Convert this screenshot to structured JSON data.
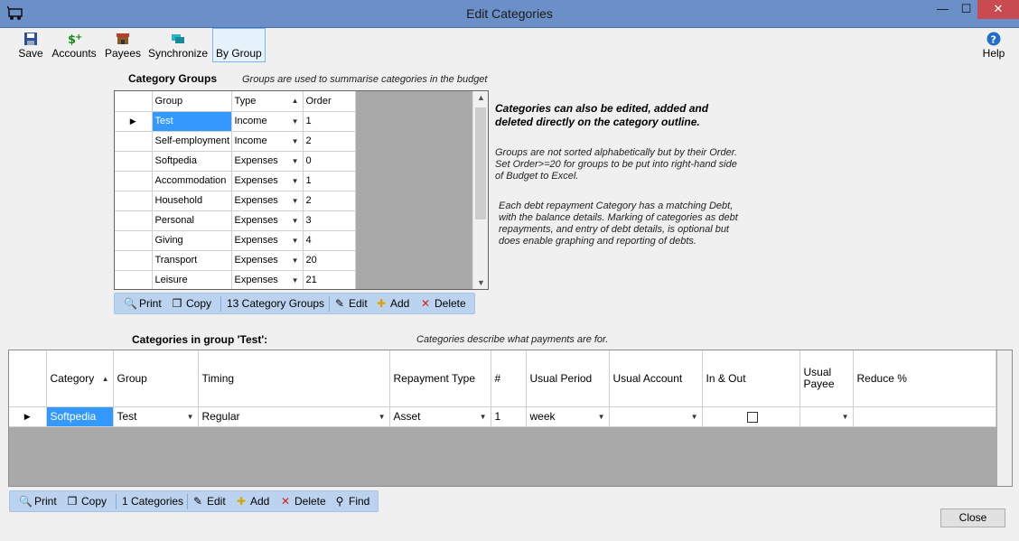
{
  "window": {
    "title": "Edit Categories",
    "close_glyph": "✕",
    "min_glyph": "—",
    "max_glyph": "☐"
  },
  "toolbar": {
    "save": "Save",
    "accounts": "Accounts",
    "payees": "Payees",
    "synchronize": "Synchronize",
    "by_group": "By Group",
    "help": "Help"
  },
  "groups_section": {
    "title": "Category Groups",
    "hint": "Groups are used to summarise categories in the budget",
    "columns": [
      "Group",
      "Type",
      "Order"
    ],
    "rows": [
      {
        "group": "Test",
        "type": "Income",
        "order": "1"
      },
      {
        "group": "Self-employment",
        "type": "Income",
        "order": "2"
      },
      {
        "group": "Softpedia",
        "type": "Expenses",
        "order": "0"
      },
      {
        "group": "Accommodation",
        "type": "Expenses",
        "order": "1"
      },
      {
        "group": "Household",
        "type": "Expenses",
        "order": "2"
      },
      {
        "group": "Personal",
        "type": "Expenses",
        "order": "3"
      },
      {
        "group": "Giving",
        "type": "Expenses",
        "order": "4"
      },
      {
        "group": "Transport",
        "type": "Expenses",
        "order": "20"
      },
      {
        "group": "Leisure",
        "type": "Expenses",
        "order": "21"
      }
    ],
    "strip": {
      "print": "Print",
      "copy": "Copy",
      "count": "13 Category Groups",
      "edit": "Edit",
      "add": "Add",
      "delete": "Delete"
    }
  },
  "info": {
    "bold": "Categories can also be edited, added and deleted directly on the category outline.",
    "p1": "Groups are not sorted alphabetically but by their Order. Set Order>=20 for groups to be put into right-hand side of Budget to Excel.",
    "p2": "Each debt repayment Category has a matching Debt, with the balance details. Marking of categories as debt repayments, and entry of debt details, is optional but does enable graphing and reporting of debts."
  },
  "categories_section": {
    "title": "Categories in group 'Test':",
    "hint": "Categories describe what payments are for.",
    "columns": [
      "Category",
      "Group",
      "Timing",
      "Repayment Type",
      "#",
      "Usual Period",
      "Usual Account",
      "In & Out",
      "Usual Payee",
      "Reduce %"
    ],
    "rows": [
      {
        "category": "Softpedia",
        "group": "Test",
        "timing": "Regular",
        "repayment_type": "Asset",
        "num": "1",
        "usual_period": "week",
        "usual_account": "",
        "in_out": false,
        "usual_payee": "",
        "reduce": ""
      }
    ],
    "strip": {
      "print": "Print",
      "copy": "Copy",
      "count": "1 Categories",
      "edit": "Edit",
      "add": "Add",
      "delete": "Delete",
      "find": "Find"
    }
  },
  "close_button": "Close",
  "colors": {
    "titlebar": "#6b8fc7",
    "selection": "#3399ff",
    "strip": "#bcd3ef",
    "grid_bg": "#a9a9a9"
  }
}
